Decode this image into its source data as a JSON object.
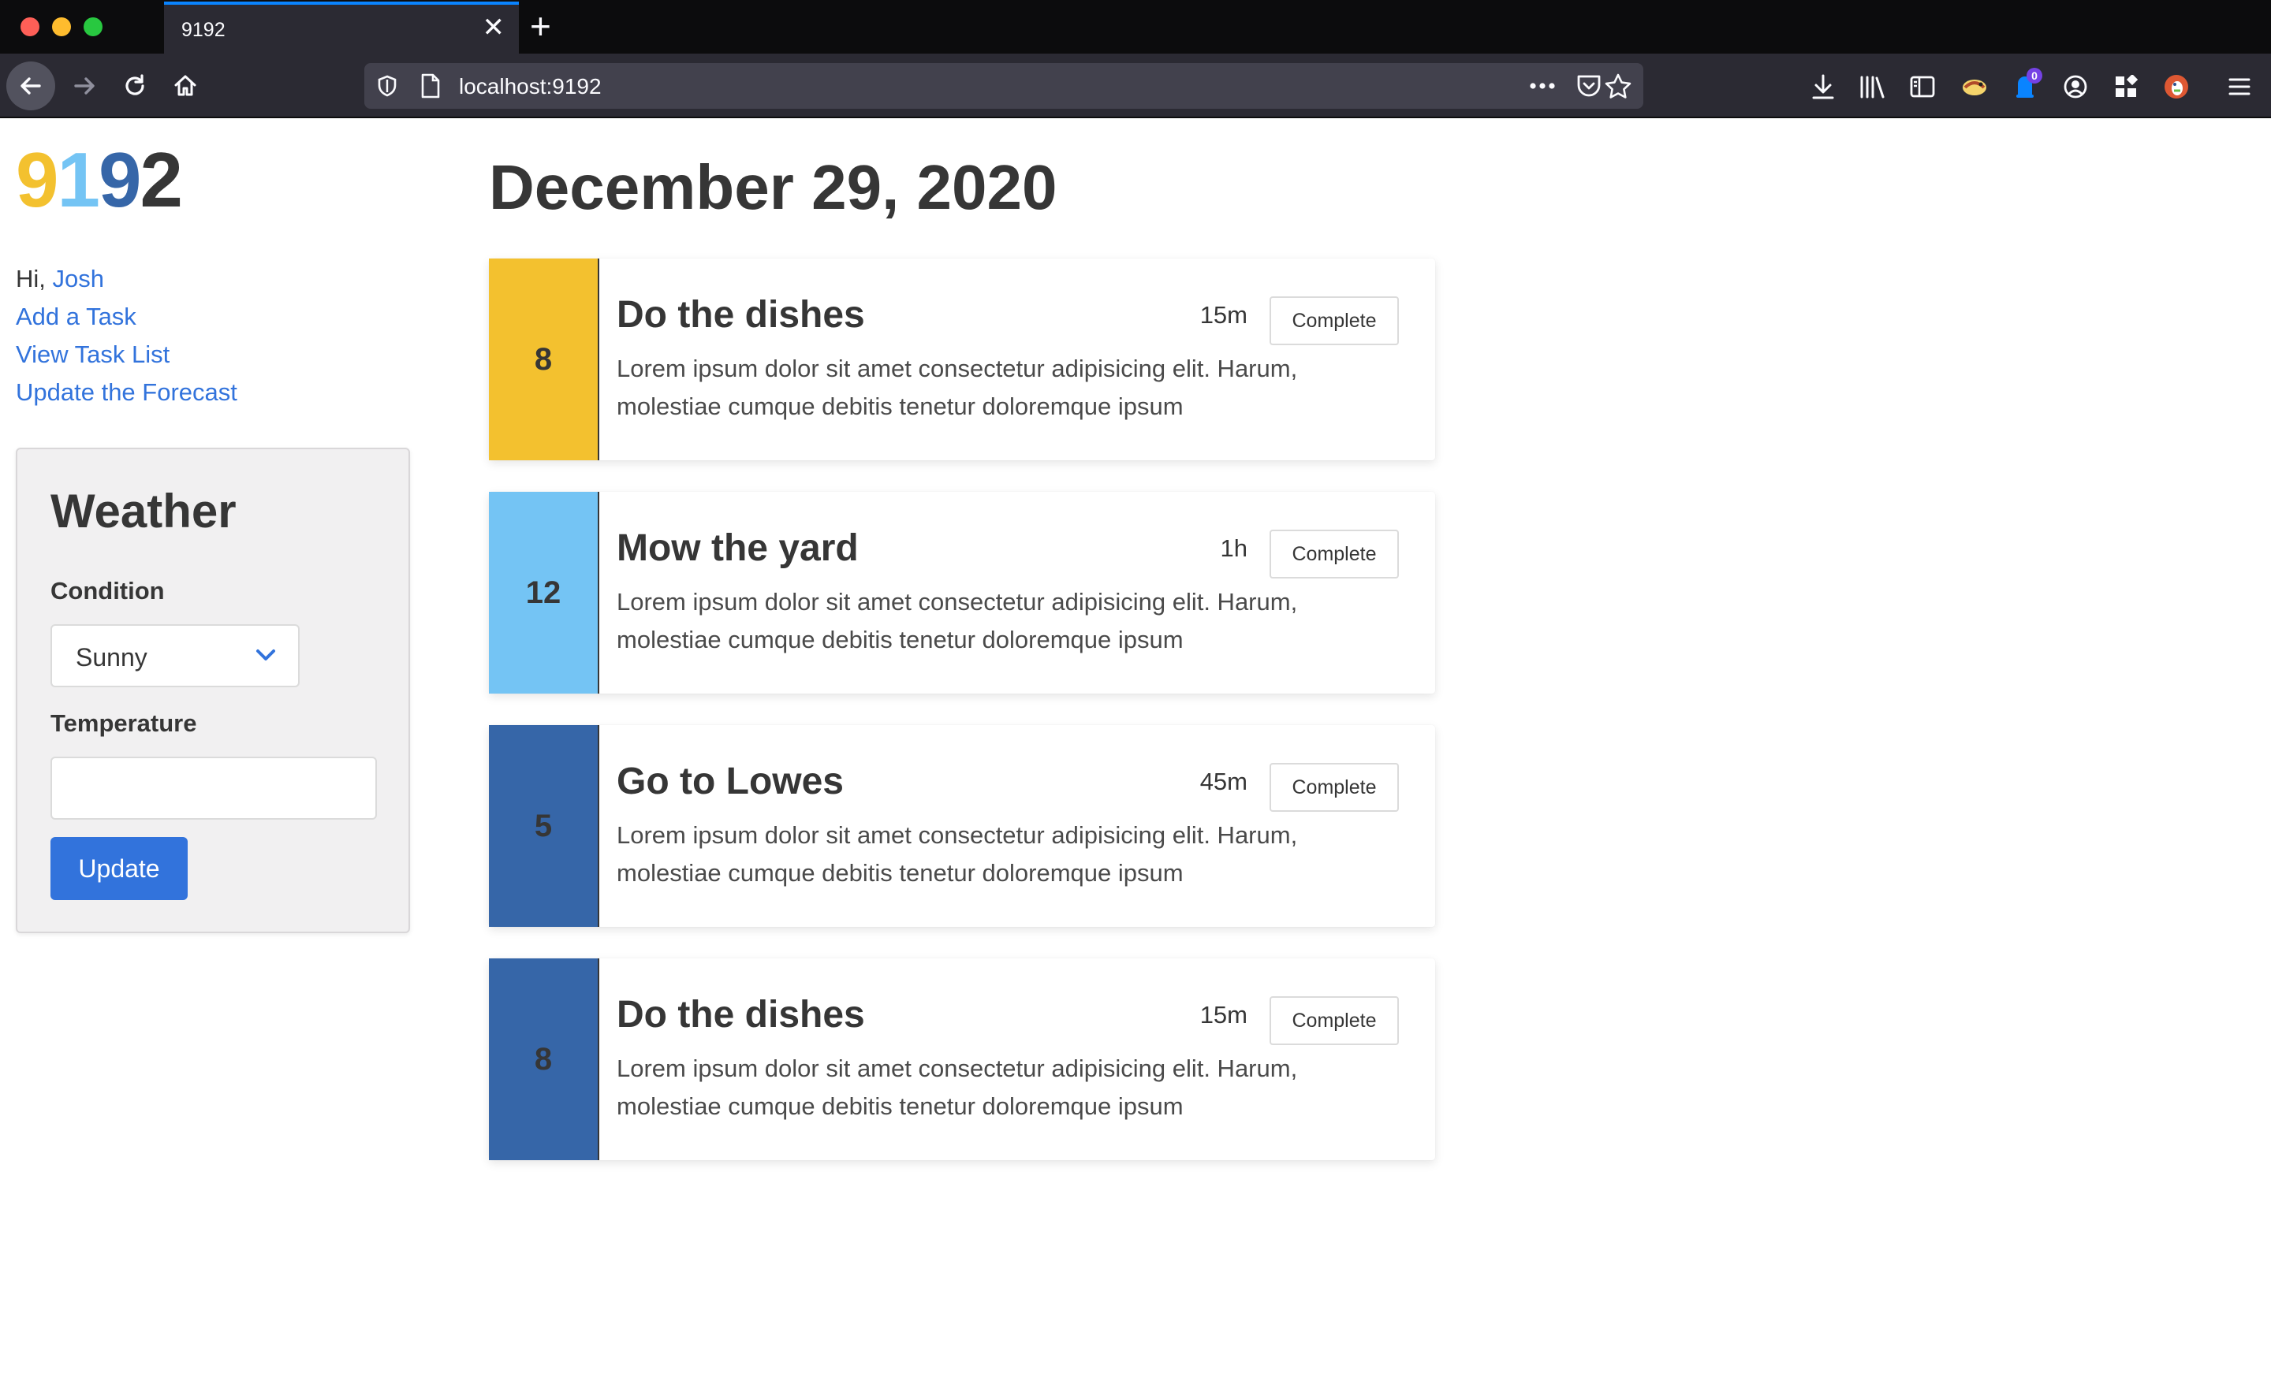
{
  "browser": {
    "tab_title": "9192",
    "url": "localhost:9192",
    "downloads_badge": "0"
  },
  "logo": {
    "d1": "9",
    "d2": "1",
    "d3": "9",
    "d4": "2"
  },
  "sidebar": {
    "greeting_prefix": "Hi, ",
    "user_name": "Josh",
    "links": [
      "Add a Task",
      "View Task List",
      "Update the Forecast"
    ]
  },
  "weather": {
    "heading": "Weather",
    "condition_label": "Condition",
    "condition_value": "Sunny",
    "temperature_label": "Temperature",
    "temperature_value": "",
    "update_label": "Update"
  },
  "main": {
    "date": "December 29, 2020",
    "complete_label": "Complete",
    "tasks": [
      {
        "number": "8",
        "title": "Do the dishes",
        "duration": "15m",
        "color": "#f3c12f",
        "description": "Lorem ipsum dolor sit amet consectetur adipisicing elit. Harum, molestiae cumque debitis tenetur doloremque ipsum"
      },
      {
        "number": "12",
        "title": "Mow the yard",
        "duration": "1h",
        "color": "#74c4f4",
        "description": "Lorem ipsum dolor sit amet consectetur adipisicing elit. Harum, molestiae cumque debitis tenetur doloremque ipsum"
      },
      {
        "number": "5",
        "title": "Go to Lowes",
        "duration": "45m",
        "color": "#3666a8",
        "description": "Lorem ipsum dolor sit amet consectetur adipisicing elit. Harum, molestiae cumque debitis tenetur doloremque ipsum"
      },
      {
        "number": "8",
        "title": "Do the dishes",
        "duration": "15m",
        "color": "#3666a8",
        "description": "Lorem ipsum dolor sit amet consectetur adipisicing elit. Harum, molestiae cumque debitis tenetur doloremque ipsum"
      }
    ]
  }
}
